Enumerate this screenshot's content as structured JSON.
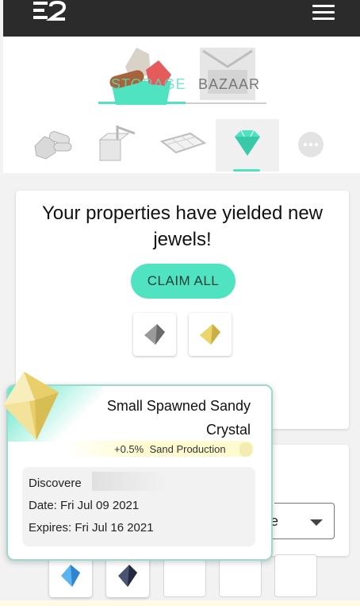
{
  "header": {
    "logo": "E2",
    "menu_icon": "hamburger-icon"
  },
  "top_tabs": [
    {
      "label": "STORAGE",
      "icon": "storage-icon",
      "active": true
    },
    {
      "label": "BAZAAR",
      "icon": "bazaar-icon",
      "active": false
    }
  ],
  "categories": [
    {
      "name": "resources-icon"
    },
    {
      "name": "buildings-icon"
    },
    {
      "name": "land-icon"
    },
    {
      "name": "jewel-icon",
      "active": true
    },
    {
      "name": "more-icon"
    }
  ],
  "yield_card": {
    "title": "Your properties have yielded new jewels!",
    "claim_label": "CLAIM ALL",
    "gems": [
      "grey-crystal-icon",
      "yellow-crystal-icon"
    ]
  },
  "filter": {
    "value": "ne",
    "label": "..."
  },
  "inventory": {
    "gems": [
      "blue-crystal-icon",
      "dark-crystal-icon"
    ],
    "empty_slots": 3
  },
  "tooltip": {
    "title": "Small Spawned Sandy Crystal",
    "bonus_value": "+0.5%",
    "bonus_label": "Sand Production",
    "discovered_label": "Discovere",
    "date_line": "Date: Fri Jul 09 2021",
    "expires_line": "Expires: Fri Jul 16 2021"
  },
  "colors": {
    "accent": "#4fe3c1",
    "topbar": "#2b2b2b",
    "tooltip_border": "#9fd8cc"
  }
}
